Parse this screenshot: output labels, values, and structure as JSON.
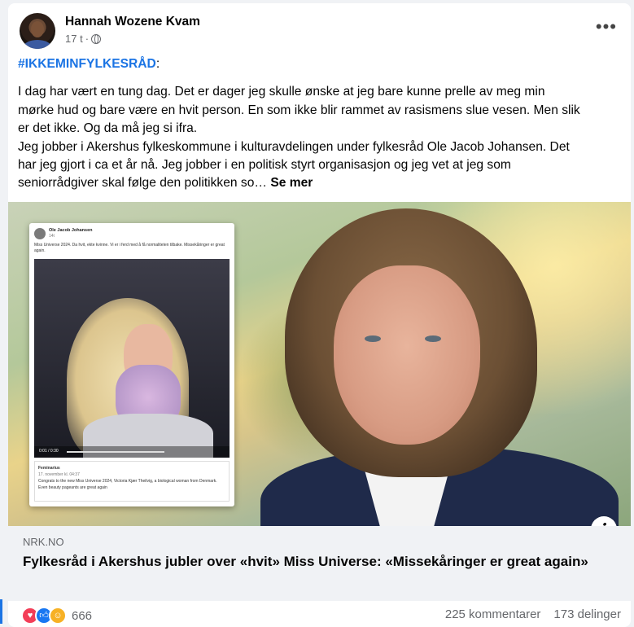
{
  "post": {
    "author": "Hannah Wozene Kvam",
    "time": "17 t",
    "time_separator": "·",
    "hashtag": "#IKKEMINFYLKESRÅD",
    "hashtag_suffix": ":",
    "text_lines": [
      "I dag har vært en tung dag. Det er dager jeg skulle ønske at jeg bare kunne prelle av meg min",
      "mørke hud og bare være en hvit person. En som ikke blir rammet av rasismens slue vesen. Men slik",
      "er det ikke. Og da må jeg si ifra.",
      "Jeg jobber i Akershus fylkeskommune i kulturavdelingen under fylkesråd Ole Jacob Johansen. Det",
      "har jeg gjort i ca et år nå. Jeg jobber i en politisk styrt organisasjon og jeg vet at jeg som",
      "seniorrådgiver skal følge den politikken so…"
    ],
    "see_more": "Se mer",
    "more_menu": "•••"
  },
  "embedded_screenshot": {
    "name": "Ole Jacob Johansen",
    "time": "14t",
    "text": "Miss Universe 2024. Da hvit, ekte kvinne. Vi er i ferd med å få normaliteten tilbake. Missekåringer er great again.",
    "time_display": "0:01 / 0:30",
    "source_name": "Feminarius",
    "source_time": "17. november kl. 04:37",
    "source_text": "Congrats to the new Miss Universe 2024, Victoria Kjær Theilvig, a biological woman from Denmark.",
    "source_text2": "Even beauty pageants are great again"
  },
  "link": {
    "source": "NRK.NO",
    "title": "Fylkesråd i Akershus jubler over «hvit» Miss Universe: «Missekåringer er great again»",
    "info_icon": "i"
  },
  "footer": {
    "reactions_count": "666",
    "comments": "225 kommentarer",
    "shares": "173 delinger",
    "reaction_icons": [
      "love-icon",
      "like-icon",
      "care-icon"
    ]
  },
  "colors": {
    "hashtag": "#1b74e4",
    "love": "#f33e58",
    "like": "#1877f2",
    "care": "#f7b125"
  }
}
